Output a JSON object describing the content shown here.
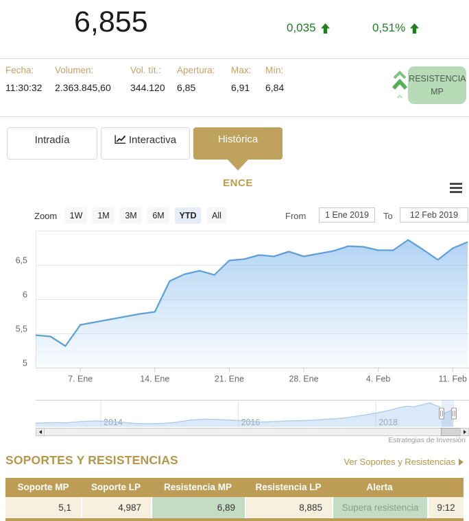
{
  "header": {
    "price": "6,855",
    "change": "0,035",
    "change_pct": "0,51%",
    "up_color": "#1e7d1e"
  },
  "info_bar": {
    "items": [
      {
        "label": "Fecha:",
        "value": "11:30:32"
      },
      {
        "label": "Volumen:",
        "value": "2.363.845,60"
      },
      {
        "label": "Vol. tít.:",
        "value": "344.120"
      },
      {
        "label": "Apertura:",
        "value": "6,85"
      },
      {
        "label": "Max:",
        "value": "6,91"
      },
      {
        "label": "Mín:",
        "value": "6,84"
      }
    ],
    "resistance_button": "RESISTENCIA MP"
  },
  "tabs": [
    {
      "label": "Intradía",
      "active": false
    },
    {
      "label": "Interactiva",
      "active": false
    },
    {
      "label": "Histórica",
      "active": true
    }
  ],
  "symbol": "ENCE",
  "chart_toolbar": {
    "zoom_label": "Zoom",
    "zoom_buttons": [
      "1W",
      "1M",
      "3M",
      "6M",
      "YTD",
      "All"
    ],
    "active_zoom": "YTD",
    "from_label": "From",
    "from_value": "1 Ene 2019",
    "to_label": "To",
    "to_value": "12 Feb 2019"
  },
  "chart_data": {
    "type": "area",
    "title": "ENCE",
    "xlabel": "",
    "ylabel": "",
    "ylim": [
      5,
      7
    ],
    "grid": true,
    "x": [
      "2 Ene",
      "3 Ene",
      "4 Ene",
      "7 Ene",
      "8 Ene",
      "9 Ene",
      "10 Ene",
      "11 Ene",
      "14 Ene",
      "15 Ene",
      "16 Ene",
      "17 Ene",
      "18 Ene",
      "21 Ene",
      "22 Ene",
      "23 Ene",
      "24 Ene",
      "25 Ene",
      "28 Ene",
      "29 Ene",
      "30 Ene",
      "31 Ene",
      "1 Feb",
      "4 Feb",
      "5 Feb",
      "6 Feb",
      "7 Feb",
      "8 Feb",
      "11 Feb",
      "12 Feb"
    ],
    "values": [
      5.48,
      5.46,
      5.32,
      5.63,
      5.67,
      5.71,
      5.75,
      5.79,
      5.82,
      6.27,
      6.37,
      6.42,
      6.36,
      6.57,
      6.59,
      6.65,
      6.63,
      6.7,
      6.63,
      6.67,
      6.71,
      6.78,
      6.77,
      6.72,
      6.72,
      6.87,
      6.73,
      6.58,
      6.75,
      6.84
    ],
    "xticks": [
      {
        "label": "7. Ene",
        "i": 3
      },
      {
        "label": "14. Ene",
        "i": 8
      },
      {
        "label": "21. Ene",
        "i": 13
      },
      {
        "label": "28. Ene",
        "i": 18
      },
      {
        "label": "4. Feb",
        "i": 23
      },
      {
        "label": "11. Feb",
        "i": 28
      }
    ],
    "yticks": [
      {
        "label": "5",
        "v": 5
      },
      {
        "label": "5,5",
        "v": 5.5
      },
      {
        "label": "6",
        "v": 6
      },
      {
        "label": "6,5",
        "v": 6.5
      }
    ],
    "line_color": "#5f9fd8",
    "fill_color": "#7eb6ec",
    "navigator": {
      "years": [
        2013.05,
        2013.3,
        2013.5,
        2013.7,
        2013.9,
        2014.1,
        2014.3,
        2014.5,
        2014.7,
        2014.9,
        2015.1,
        2015.3,
        2015.5,
        2015.7,
        2015.9,
        2016.1,
        2016.3,
        2016.5,
        2016.7,
        2016.9,
        2017.1,
        2017.3,
        2017.5,
        2017.7,
        2017.9,
        2018.05,
        2018.2,
        2018.35,
        2018.45,
        2018.55,
        2018.62,
        2018.7,
        2018.78,
        2018.85,
        2018.92,
        2019.0,
        2019.08,
        2019.12
      ],
      "values": [
        2.3,
        2.5,
        2.4,
        2.8,
        3.0,
        2.9,
        2.6,
        2.2,
        2.1,
        2.2,
        2.6,
        3.3,
        3.6,
        3.5,
        3.3,
        3.0,
        2.7,
        2.8,
        3.0,
        3.1,
        3.3,
        3.6,
        3.9,
        4.5,
        5.2,
        5.8,
        6.5,
        7.4,
        7.8,
        7.6,
        8.0,
        8.4,
        8.9,
        8.2,
        7.7,
        5.5,
        6.3,
        6.85
      ],
      "year_ticks": [
        "2014",
        "2016",
        "2018"
      ],
      "line_color": "#a5c8e8"
    }
  },
  "credit": "Estrategias de Inversión",
  "sr_section": {
    "title": "SOPORTES Y RESISTENCIAS",
    "link": "Ver Soportes y Resistencias"
  },
  "sr_table": {
    "headers": [
      "Soporte MP",
      "Soporte LP",
      "Resistencia MP",
      "Resistencia LP",
      "Alerta"
    ],
    "row": {
      "soporte_mp": "5,1",
      "soporte_lp": "4,987",
      "resistencia_mp": "6,89",
      "resistencia_lp": "8,885",
      "alerta": "Supera resistencia",
      "hora": "9:12"
    }
  },
  "colors": {
    "gold": "#bda15c",
    "gold_text": "#b5964a",
    "table_header_gold": "#bd9d55",
    "cream": "#f7f0df",
    "cell_green": "#c3dcc3",
    "button_green": "#b6dbb6",
    "change_green": "#1e7d1e"
  }
}
